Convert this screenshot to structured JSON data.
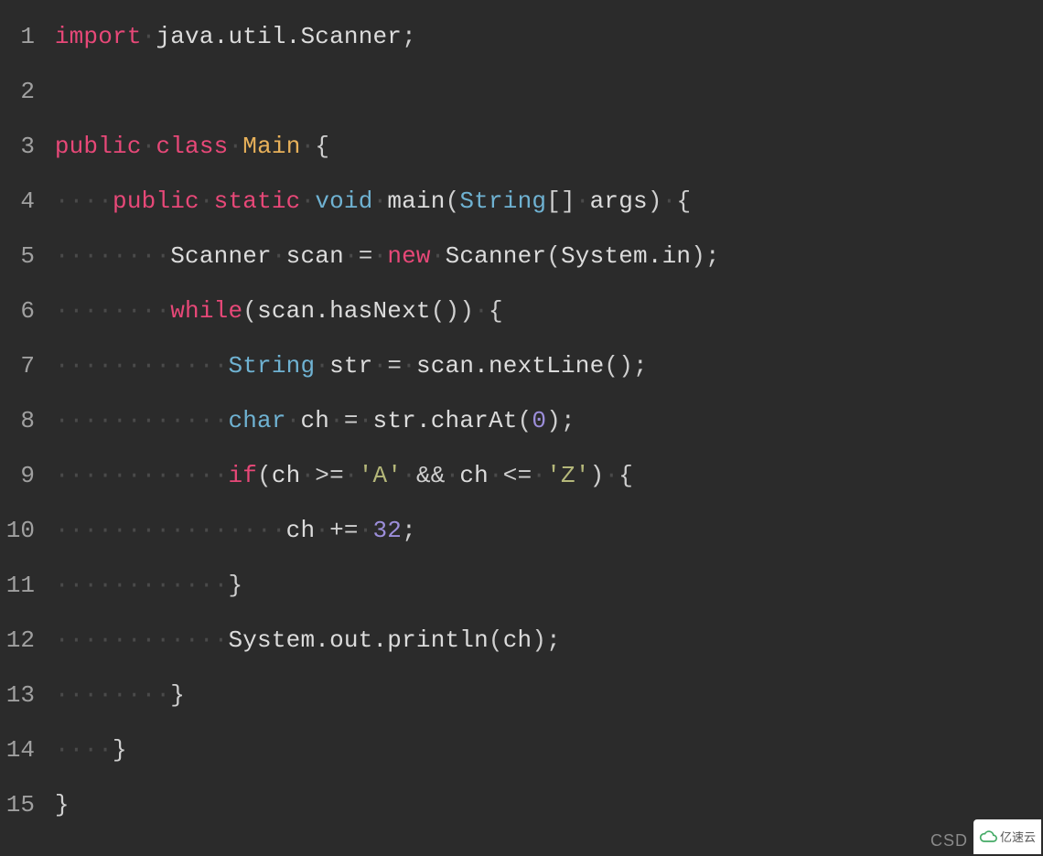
{
  "lines": [
    {
      "num": "1"
    },
    {
      "num": "2"
    },
    {
      "num": "3"
    },
    {
      "num": "4"
    },
    {
      "num": "5"
    },
    {
      "num": "6"
    },
    {
      "num": "7"
    },
    {
      "num": "8"
    },
    {
      "num": "9"
    },
    {
      "num": "10"
    },
    {
      "num": "11"
    },
    {
      "num": "12"
    },
    {
      "num": "13"
    },
    {
      "num": "14"
    },
    {
      "num": "15"
    }
  ],
  "tokens": {
    "l1": {
      "import": "import",
      "pkg": "java.util.Scanner",
      "semi": ";"
    },
    "l3": {
      "public": "public",
      "class": "class",
      "name": "Main",
      "lb": "{"
    },
    "l4": {
      "public": "public",
      "static": "static",
      "void": "void",
      "main": "main",
      "lp": "(",
      "String": "String",
      "br": "[]",
      "args": "args",
      "rp": ")",
      "lb": "{"
    },
    "l5": {
      "Scanner1": "Scanner",
      "scan": "scan",
      "eq": "=",
      "new": "new",
      "Scanner2": "Scanner",
      "lp": "(",
      "Systemin": "System.in",
      "rp": ")",
      "semi": ";"
    },
    "l6": {
      "while": "while",
      "lp": "(",
      "scan": "scan.hasNext",
      "par": "()",
      "rp": ")",
      "lb": "{"
    },
    "l7": {
      "String": "String",
      "str": "str",
      "eq": "=",
      "call": "scan.nextLine",
      "par": "()",
      "semi": ";"
    },
    "l8": {
      "char": "char",
      "ch": "ch",
      "eq": "=",
      "call": "str.charAt",
      "lp": "(",
      "zero": "0",
      "rp": ")",
      "semi": ";"
    },
    "l9": {
      "if": "if",
      "lp": "(",
      "ch1": "ch",
      "ge": ">=",
      "A": "'A'",
      "and": "&&",
      "ch2": "ch",
      "le": "<=",
      "Z": "'Z'",
      "rp": ")",
      "lb": "{"
    },
    "l10": {
      "ch": "ch",
      "pe": "+=",
      "n": "32",
      "semi": ";"
    },
    "l11": {
      "rb": "}"
    },
    "l12": {
      "call": "System.out.println",
      "lp": "(",
      "ch": "ch",
      "rp": ")",
      "semi": ";"
    },
    "l13": {
      "rb": "}"
    },
    "l14": {
      "rb": "}"
    },
    "l15": {
      "rb": "}"
    }
  },
  "watermark": {
    "csd": "CSD",
    "logo_text": "亿速云"
  }
}
